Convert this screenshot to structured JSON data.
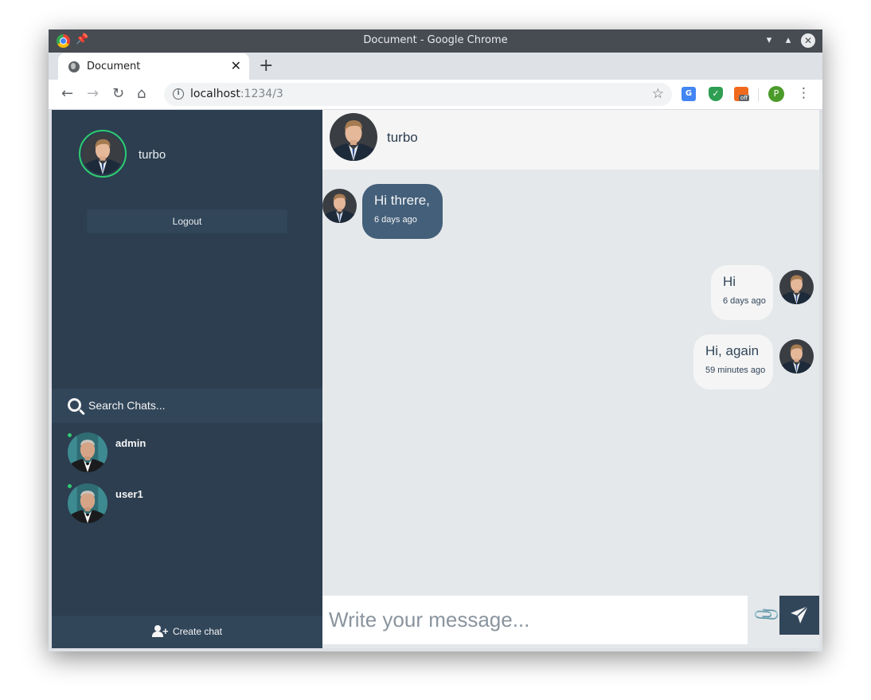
{
  "browser": {
    "window_title": "Document - Google Chrome",
    "tab_title": "Document",
    "url_host": "localhost",
    "url_path": ":1234/3",
    "profile_initial": "P",
    "ext_off_label": "off"
  },
  "sidebar": {
    "profile_name": "turbo",
    "logout_label": "Logout",
    "search_placeholder": "Search Chats...",
    "contacts": [
      {
        "name": "admin",
        "status": "online"
      },
      {
        "name": "user1",
        "status": "online"
      }
    ],
    "create_chat_label": "Create chat"
  },
  "chat": {
    "contact_name": "turbo",
    "messages": [
      {
        "direction": "received",
        "text": "Hi threre,",
        "time": "6 days ago"
      },
      {
        "direction": "sent",
        "text": "Hi",
        "time": "6 days ago"
      },
      {
        "direction": "sent",
        "text": "Hi, again",
        "time": "59 minutes ago"
      }
    ],
    "input_placeholder": "Write your message..."
  },
  "colors": {
    "sidebar_bg": "#2c3e50",
    "sidebar_panel": "#32465a",
    "received_bubble": "#435f7a",
    "sent_bubble": "#f5f5f5",
    "online": "#2ecc71",
    "chat_bg": "#e5e8ea"
  }
}
